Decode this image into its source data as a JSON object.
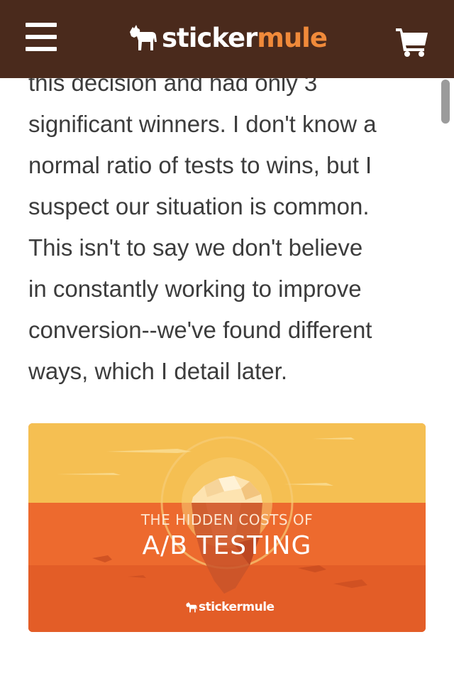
{
  "header": {
    "brand_part1": "sticker",
    "brand_part2": "mule",
    "menu_icon": "hamburger-menu-icon",
    "cart_icon": "shopping-cart-icon",
    "background_color": "#4a2a1c",
    "brand_accent_color": "#f08a3a"
  },
  "article": {
    "lines": [
      "this decision and had only 3",
      "significant winners. I don't know a",
      "normal ratio of tests to wins, but I",
      "suspect our situation is common.",
      "This isn't to say we don't believe",
      "in constantly working to improve",
      "conversion--we've found different",
      "ways, which I detail later."
    ]
  },
  "banner": {
    "subtitle": "THE HIDDEN COSTS OF",
    "title": "A/B TESTING",
    "brand": "stickermule",
    "sky_color": "#f5bf52",
    "sea_color": "#ed6a2e"
  }
}
